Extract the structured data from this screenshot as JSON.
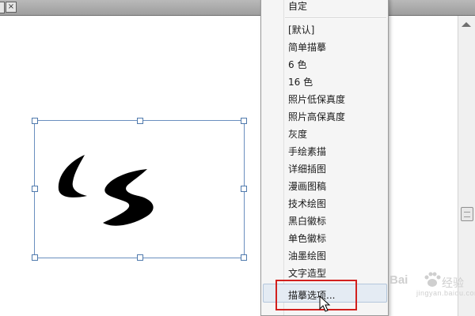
{
  "document_tab": {
    "close_glyph": "×"
  },
  "menu": {
    "top_item": "自定",
    "items": [
      "[默认]",
      "简单描摹",
      "6 色",
      "16 色",
      "照片低保真度",
      "照片高保真度",
      "灰度",
      "手绘素描",
      "详细插图",
      "漫画图稿",
      "技术绘图",
      "黑白徽标",
      "单色徽标",
      "油墨绘图",
      "文字造型"
    ],
    "bottom_item": "描摹选项...",
    "hover_color": "#e4ebf3",
    "callout_color": "#d2201e"
  },
  "watermark": {
    "brand": "Bai",
    "brand_cn": "经验",
    "url": "jingyan.baidu.com",
    "paw_icon": "paw-icon"
  },
  "artwork": {
    "fill": "#000000"
  }
}
